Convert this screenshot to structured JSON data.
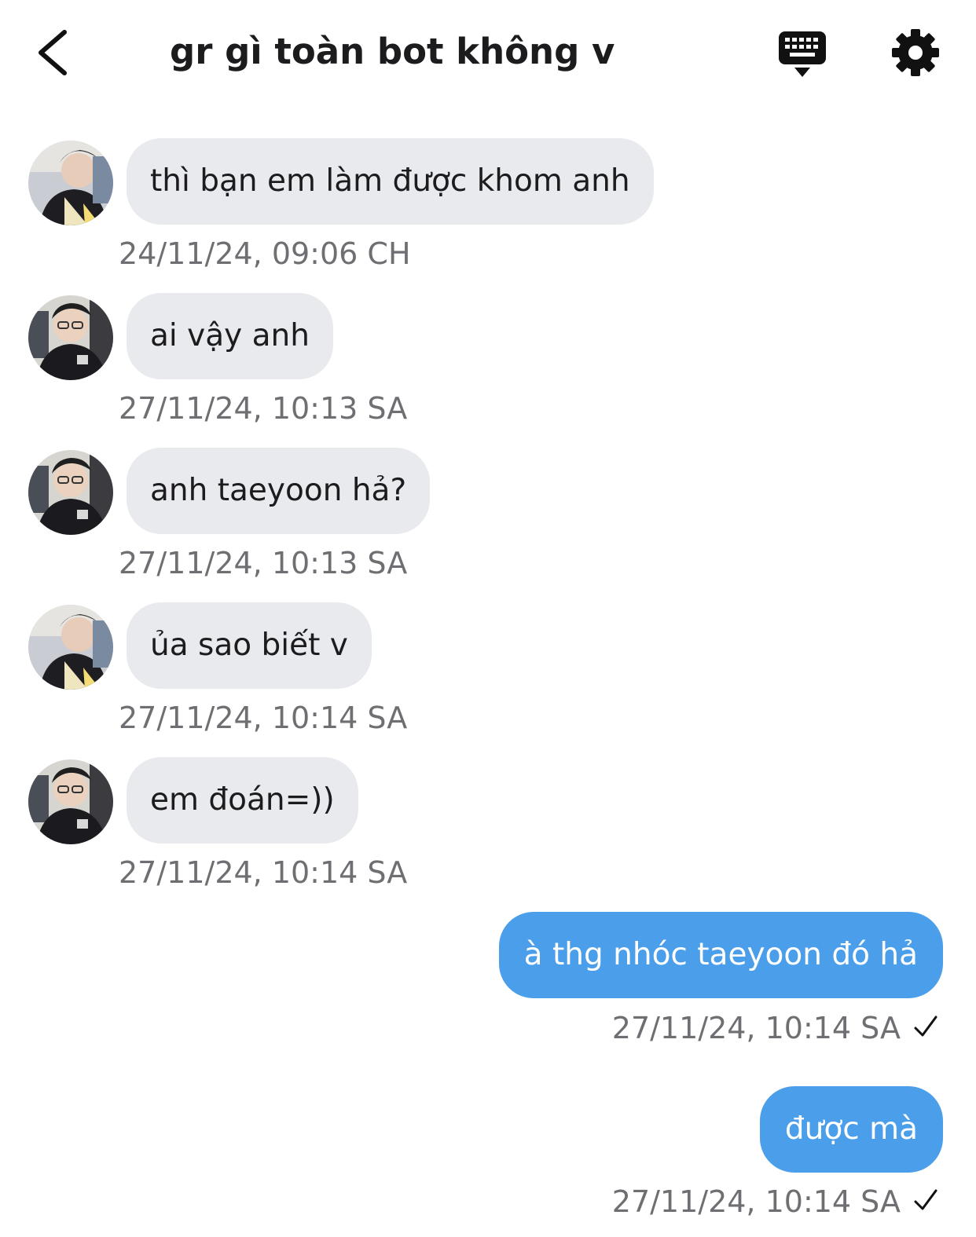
{
  "header": {
    "title": "gr gì toàn bot không v"
  },
  "messages": [
    {
      "direction": "in",
      "avatar": "avatar-a",
      "text": "thì bạn em làm được khom anh",
      "time": "24/11/24, 09:06 CH"
    },
    {
      "direction": "in",
      "avatar": "avatar-b",
      "text": "ai vậy anh",
      "time": "27/11/24, 10:13 SA"
    },
    {
      "direction": "in",
      "avatar": "avatar-b",
      "text": "anh taeyoon hả?",
      "time": "27/11/24, 10:13 SA"
    },
    {
      "direction": "in",
      "avatar": "avatar-a",
      "text": "ủa sao biết v",
      "time": "27/11/24, 10:14 SA"
    },
    {
      "direction": "in",
      "avatar": "avatar-b",
      "text": "em đoán=))",
      "time": "27/11/24, 10:14 SA"
    },
    {
      "direction": "out",
      "text": "à thg nhóc taeyoon đó hả",
      "time": "27/11/24, 10:14 SA",
      "status": "sent-check-icon"
    },
    {
      "direction": "out",
      "text": "được mà",
      "time": "27/11/24, 10:14 SA",
      "status": "sent-check-icon"
    }
  ],
  "colors": {
    "incoming_bubble": "#e9eaee",
    "outgoing_bubble": "#4a9eea",
    "timestamp": "#6e6e73",
    "title": "#1c1c1e"
  }
}
